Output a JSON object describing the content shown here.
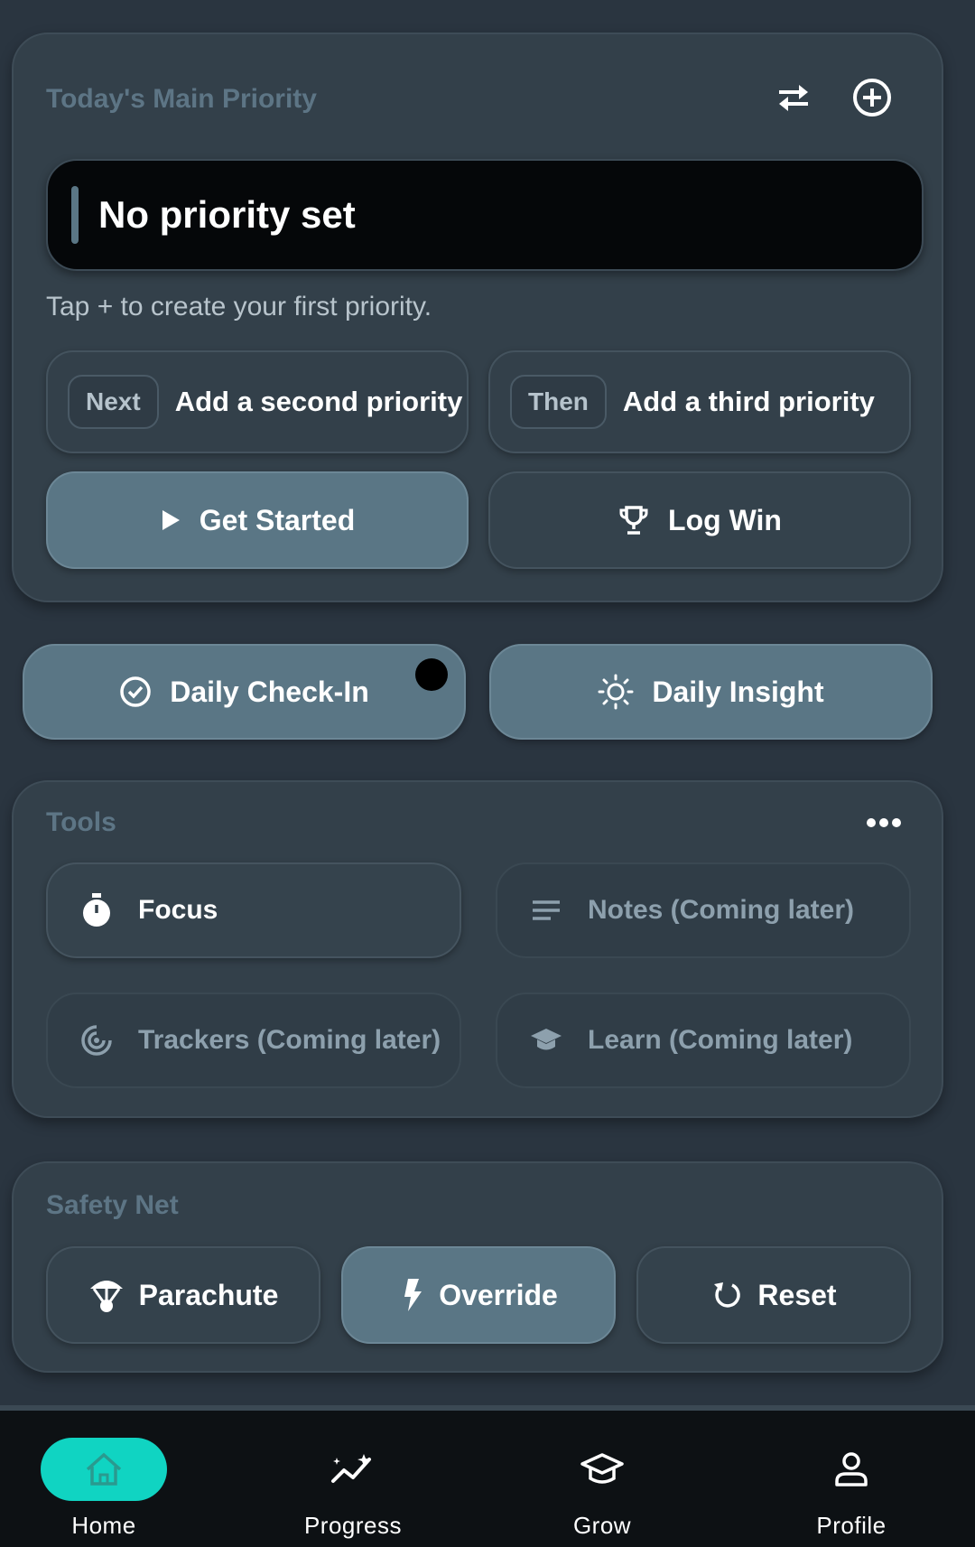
{
  "priority_panel": {
    "title": "Today's Main Priority",
    "main_priority": "No priority set",
    "hint": "Tap + to create your first priority.",
    "second": {
      "tag": "Next",
      "label": "Add a second priority"
    },
    "third": {
      "tag": "Then",
      "label": "Add a third priority"
    },
    "get_started_label": "Get Started",
    "log_win_label": "Log Win"
  },
  "daily": {
    "checkin_label": "Daily Check-In",
    "insight_label": "Daily Insight"
  },
  "tools": {
    "title": "Tools",
    "items": [
      {
        "label": "Focus"
      },
      {
        "label": "Notes (Coming later)"
      },
      {
        "label": "Trackers (Coming later)"
      },
      {
        "label": "Learn (Coming later)"
      }
    ]
  },
  "safety_net": {
    "title": "Safety Net",
    "buttons": [
      {
        "label": "Parachute"
      },
      {
        "label": "Override"
      },
      {
        "label": "Reset"
      }
    ]
  },
  "nav": {
    "items": [
      {
        "label": "Home"
      },
      {
        "label": "Progress"
      },
      {
        "label": "Grow"
      },
      {
        "label": "Profile"
      }
    ],
    "active_color": "#10d4c2"
  }
}
